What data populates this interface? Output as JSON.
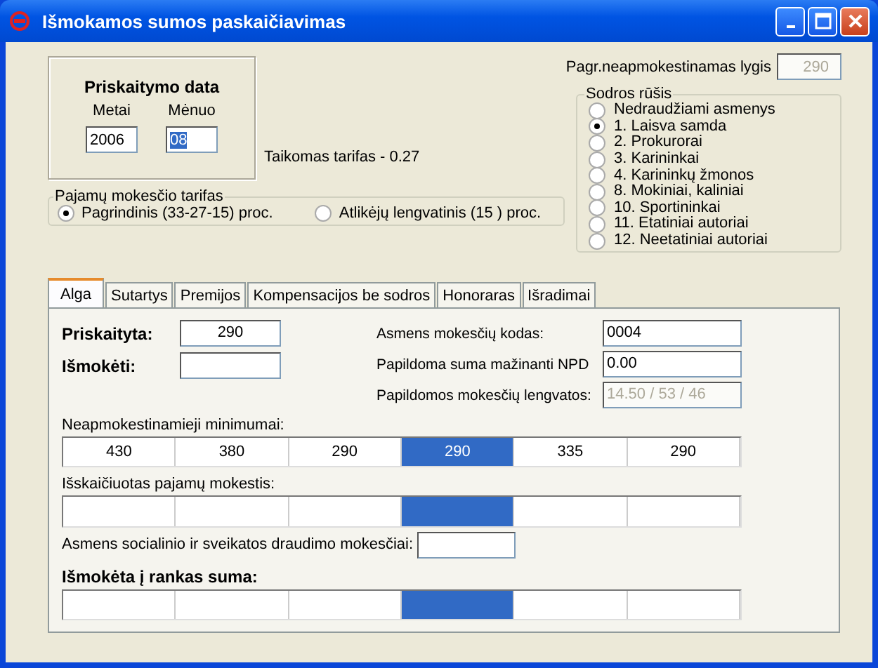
{
  "window": {
    "title": "Išmokamos sumos paskaičiavimas"
  },
  "date_box": {
    "title": "Priskaitymo data",
    "year": {
      "label": "Metai",
      "value": "2006"
    },
    "month": {
      "label": "Mėnuo",
      "value": "08",
      "selected": true
    }
  },
  "applied_rate": "Taikomas tarifas - 0.27",
  "income_tax_rate": {
    "legend": "Pajamų mokesčio tarifas",
    "options": [
      {
        "label": "Pagrindinis (33-27-15) proc.",
        "selected": true
      },
      {
        "label": "Atlikėjų lengvatinis (15 ) proc.",
        "selected": false
      }
    ]
  },
  "basic_level": {
    "label": "Pagr.neapmokestinamas lygis",
    "value": "290",
    "disabled": true
  },
  "sodra_type": {
    "legend": "Sodros rūšis",
    "options": [
      {
        "label": "Nedraudžiami asmenys",
        "selected": false
      },
      {
        "label": "1. Laisva samda",
        "selected": true
      },
      {
        "label": "2. Prokurorai",
        "selected": false
      },
      {
        "label": "3. Karininkai",
        "selected": false
      },
      {
        "label": "4. Karininkų žmonos",
        "selected": false
      },
      {
        "label": "8. Mokiniai, kaliniai",
        "selected": false
      },
      {
        "label": "10. Sportininkai",
        "selected": false
      },
      {
        "label": "11. Etatiniai autoriai",
        "selected": false
      },
      {
        "label": "12. Neetatiniai autoriai",
        "selected": false
      }
    ]
  },
  "tabs": [
    {
      "label": "Alga",
      "selected": true
    },
    {
      "label": "Sutartys",
      "selected": false
    },
    {
      "label": "Premijos",
      "selected": false
    },
    {
      "label": "Kompensacijos be sodros",
      "selected": false
    },
    {
      "label": "Honoraras",
      "selected": false
    },
    {
      "label": "Išradimai",
      "selected": false
    }
  ],
  "left_fields": [
    {
      "label": "Priskaityta:",
      "value": "290"
    },
    {
      "label": "Išmokėti:"
    }
  ],
  "right_fields": [
    {
      "label": "Asmens mokesčių kodas:",
      "value": "0004",
      "disabled": false
    },
    {
      "label": "Papildoma suma mažinanti NPD",
      "value": " 0.00",
      "disabled": false
    },
    {
      "label": "Papildomos mokesčių lengvatos:",
      "value": "14.50 / 53 / 46",
      "disabled": true
    }
  ],
  "grids": [
    {
      "label": "Neapmokestinamieji minimumai:",
      "bold": false,
      "cells": [
        {
          "value": "430",
          "selected": false
        },
        {
          "value": "380",
          "selected": false
        },
        {
          "value": "290",
          "selected": false
        },
        {
          "value": "290",
          "selected": true
        },
        {
          "value": "335",
          "selected": false
        },
        {
          "value": "290",
          "selected": false
        }
      ]
    },
    {
      "label": "Išskaičiuotas pajamų mokestis:",
      "bold": false,
      "cells": [
        {
          "selected": false
        },
        {
          "selected": false
        },
        {
          "selected": false
        },
        {
          "selected": true
        },
        {
          "selected": false
        },
        {
          "selected": false
        }
      ]
    },
    {
      "label": "Asmens socialinio ir sveikatos draudimo mokesčiai:",
      "kind": "field"
    },
    {
      "label": "Išmokėta į rankas suma:",
      "bold": true,
      "cells": [
        {
          "selected": false
        },
        {
          "selected": false
        },
        {
          "selected": false
        },
        {
          "selected": true
        },
        {
          "selected": false
        },
        {
          "selected": false
        }
      ]
    }
  ]
}
